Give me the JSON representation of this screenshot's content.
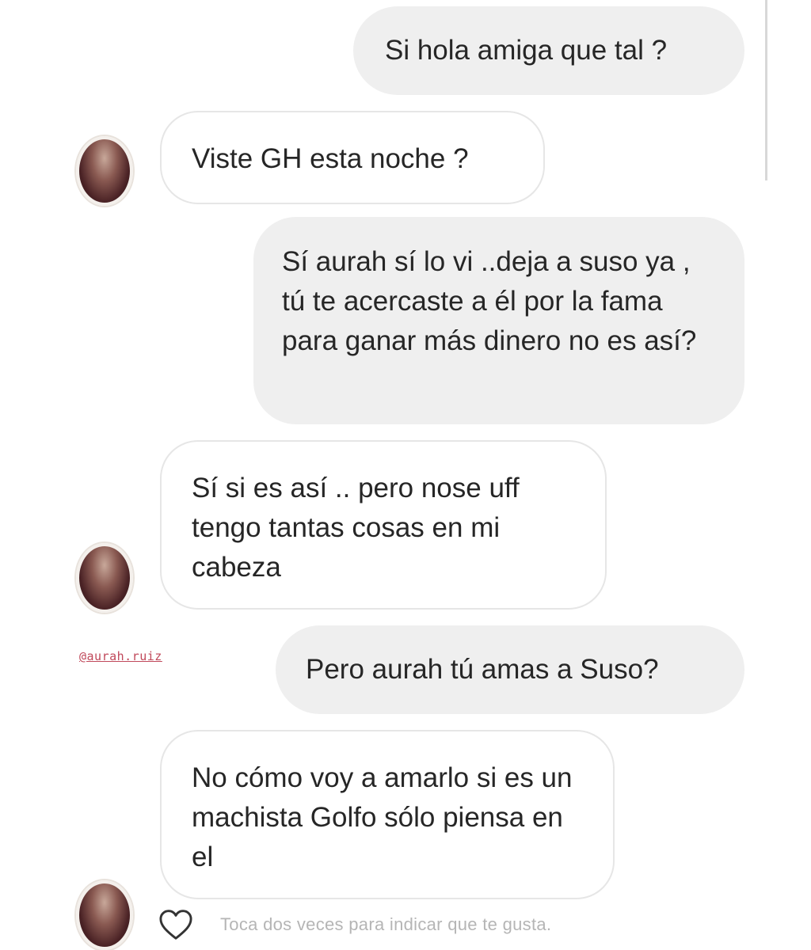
{
  "conversation": {
    "messages": [
      {
        "direction": "outgoing",
        "text": "Si hola amiga que tal ?"
      },
      {
        "direction": "incoming",
        "text": "Viste GH esta noche ?"
      },
      {
        "direction": "outgoing",
        "text": "Sí aurah sí lo vi ..deja a suso ya , tú te acercaste a él por la fama para ganar más dinero no es así?"
      },
      {
        "direction": "incoming",
        "text": "Sí si es así .. pero nose uff tengo tantas cosas en mi cabeza"
      },
      {
        "direction": "outgoing",
        "text": "Pero aurah tú amas a Suso?"
      },
      {
        "direction": "incoming",
        "text": "No cómo voy a amarlo si es un machista Golfo sólo piensa en el"
      }
    ]
  },
  "watermark_tag": "@aurah.ruiz",
  "footer": {
    "like_icon": "heart-outline-icon",
    "hint": "Toca dos veces para indicar que te gusta."
  },
  "colors": {
    "outgoing_bubble": "#efefef",
    "incoming_bubble_border": "#e6e6e6",
    "text": "#262626",
    "tag": "#c0485a",
    "hint": "#b5b5b5"
  }
}
